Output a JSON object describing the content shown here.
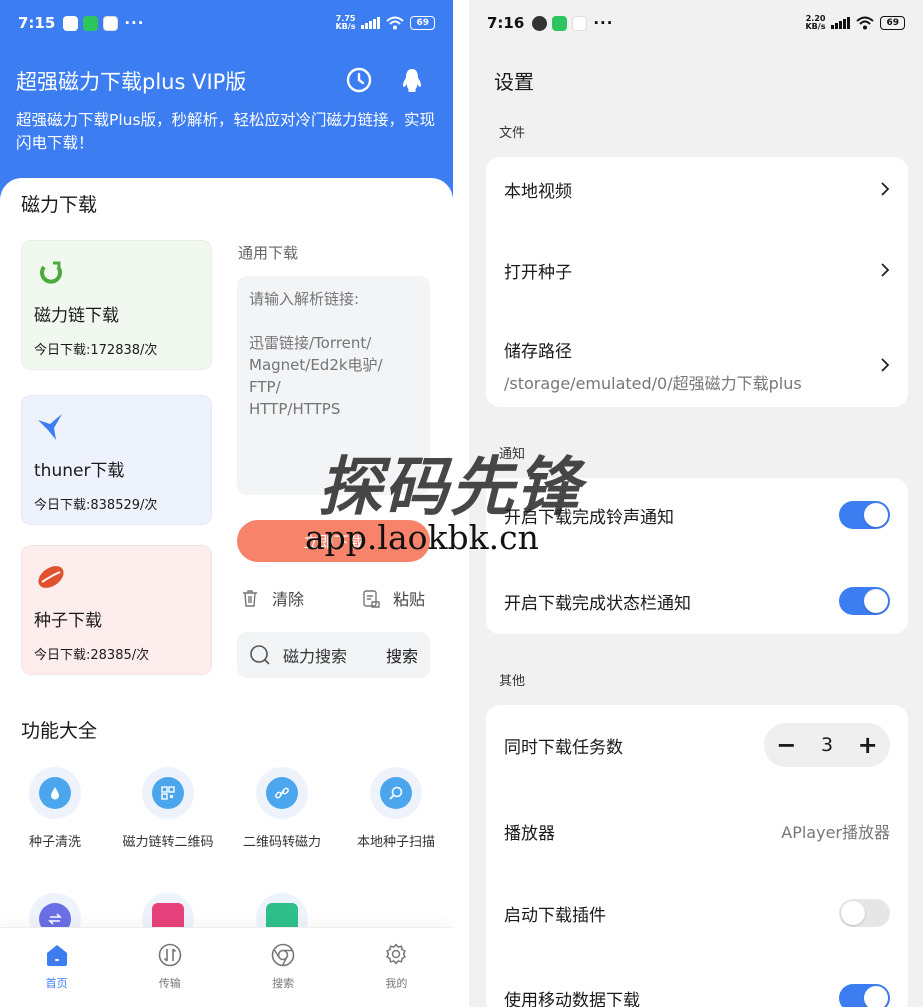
{
  "left": {
    "status": {
      "time": "7:15",
      "speed_top": "7.75",
      "speed_bottom": "KB/s",
      "battery": "69",
      "dots": "···"
    },
    "header": {
      "title": "超强磁力下载plus VIP版",
      "desc": "超强磁力下载Plus版，秒解析，轻松应对冷门磁力链接，实现闪电下载！"
    },
    "magnet_section": "磁力下载",
    "cards": [
      {
        "name": "磁力链下载",
        "count": "今日下载:172838/次"
      },
      {
        "name": "thuner下载",
        "count": "今日下载:838529/次"
      },
      {
        "name": "种子下载",
        "count": "今日下载:28385/次"
      }
    ],
    "general_label": "通用下载",
    "input_placeholder": "请输入解析链接:\n\n迅雷链接/Torrent/\nMagnet/Ed2k电驴/\nFTP/\nHTTP/HTTPS",
    "download_button": "立即下载",
    "clear": "清除",
    "paste": "粘贴",
    "search_placeholder": "磁力搜索",
    "search_button": "搜索",
    "features_section": "功能大全",
    "features": [
      {
        "label": "种子清洗"
      },
      {
        "label": "磁力链转二维码"
      },
      {
        "label": "二维码转磁力"
      },
      {
        "label": "本地种子扫描"
      }
    ],
    "tabs": [
      {
        "label": "首页"
      },
      {
        "label": "传输"
      },
      {
        "label": "搜索"
      },
      {
        "label": "我的"
      }
    ]
  },
  "right": {
    "status": {
      "time": "7:16",
      "speed_top": "2.20",
      "speed_bottom": "KB/s",
      "battery": "69",
      "dots": "···"
    },
    "title": "设置",
    "file_label": "文件",
    "local_video": "本地视频",
    "open_torrent": "打开种子",
    "storage_path": "储存路径",
    "storage_value": "/storage/emulated/0/超强磁力下载plus",
    "notify_label": "通知",
    "notify_ring": "开启下载完成铃声通知",
    "notify_bar": "开启下载完成状态栏通知",
    "other_label": "其他",
    "concurrent": "同时下载任务数",
    "concurrent_value": "3",
    "minus": "−",
    "plus": "+",
    "player": "播放器",
    "player_value": "APlayer播放器",
    "plugin": "启动下载插件",
    "mobile_data": "使用移动数据下载"
  },
  "toggles": {
    "notify_ring": true,
    "notify_bar": true,
    "plugin": false,
    "mobile_data": true
  },
  "watermark": {
    "cn": "探码先锋",
    "url": "app.laokbk.cn"
  },
  "colors": {
    "primary": "#3d7df2",
    "accent_green": "#7de13a",
    "download_btn": "#f6836a"
  }
}
